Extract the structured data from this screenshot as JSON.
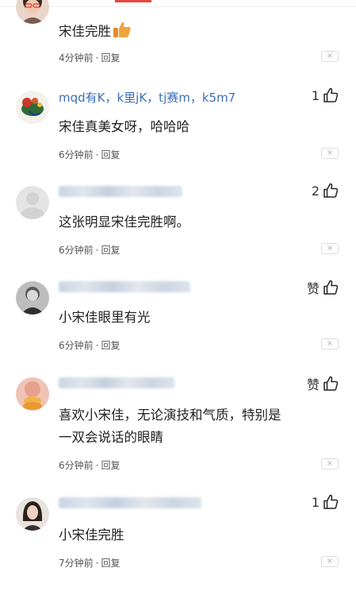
{
  "comments": [
    {
      "text": "宋佳完胜",
      "meta": {
        "time": "4分钟前",
        "sep": "·",
        "reply": "回复"
      },
      "close_glyph": "×"
    },
    {
      "username": "mqd有K，k里jK，tj赛m，k5m7",
      "likes": "1",
      "text": "宋佳真美女呀，哈哈哈",
      "meta": {
        "time": "6分钟前",
        "sep": "·",
        "reply": "回复"
      },
      "close_glyph": "×"
    },
    {
      "likes": "2",
      "text": "这张明显宋佳完胜啊。",
      "meta": {
        "time": "6分钟前",
        "sep": "·",
        "reply": "回复"
      },
      "close_glyph": "×"
    },
    {
      "likes": "赞",
      "text": "小宋佳眼里有光",
      "meta": {
        "time": "6分钟前",
        "sep": "·",
        "reply": "回复"
      },
      "close_glyph": "×"
    },
    {
      "likes": "赞",
      "text_line1": "喜欢小宋佳，无论演技和气质，特别是",
      "text_line2": "一双会说话的眼睛",
      "meta": {
        "time": "6分钟前",
        "sep": "·",
        "reply": "回复"
      },
      "close_glyph": "×"
    },
    {
      "likes": "1",
      "text": "小宋佳完胜",
      "meta": {
        "time": "7分钟前",
        "sep": "·",
        "reply": "回复"
      },
      "close_glyph": "×"
    }
  ],
  "colors": {
    "username": "#3b6fb6",
    "accent": "#e8463c",
    "emoji": "#f0a53a"
  }
}
